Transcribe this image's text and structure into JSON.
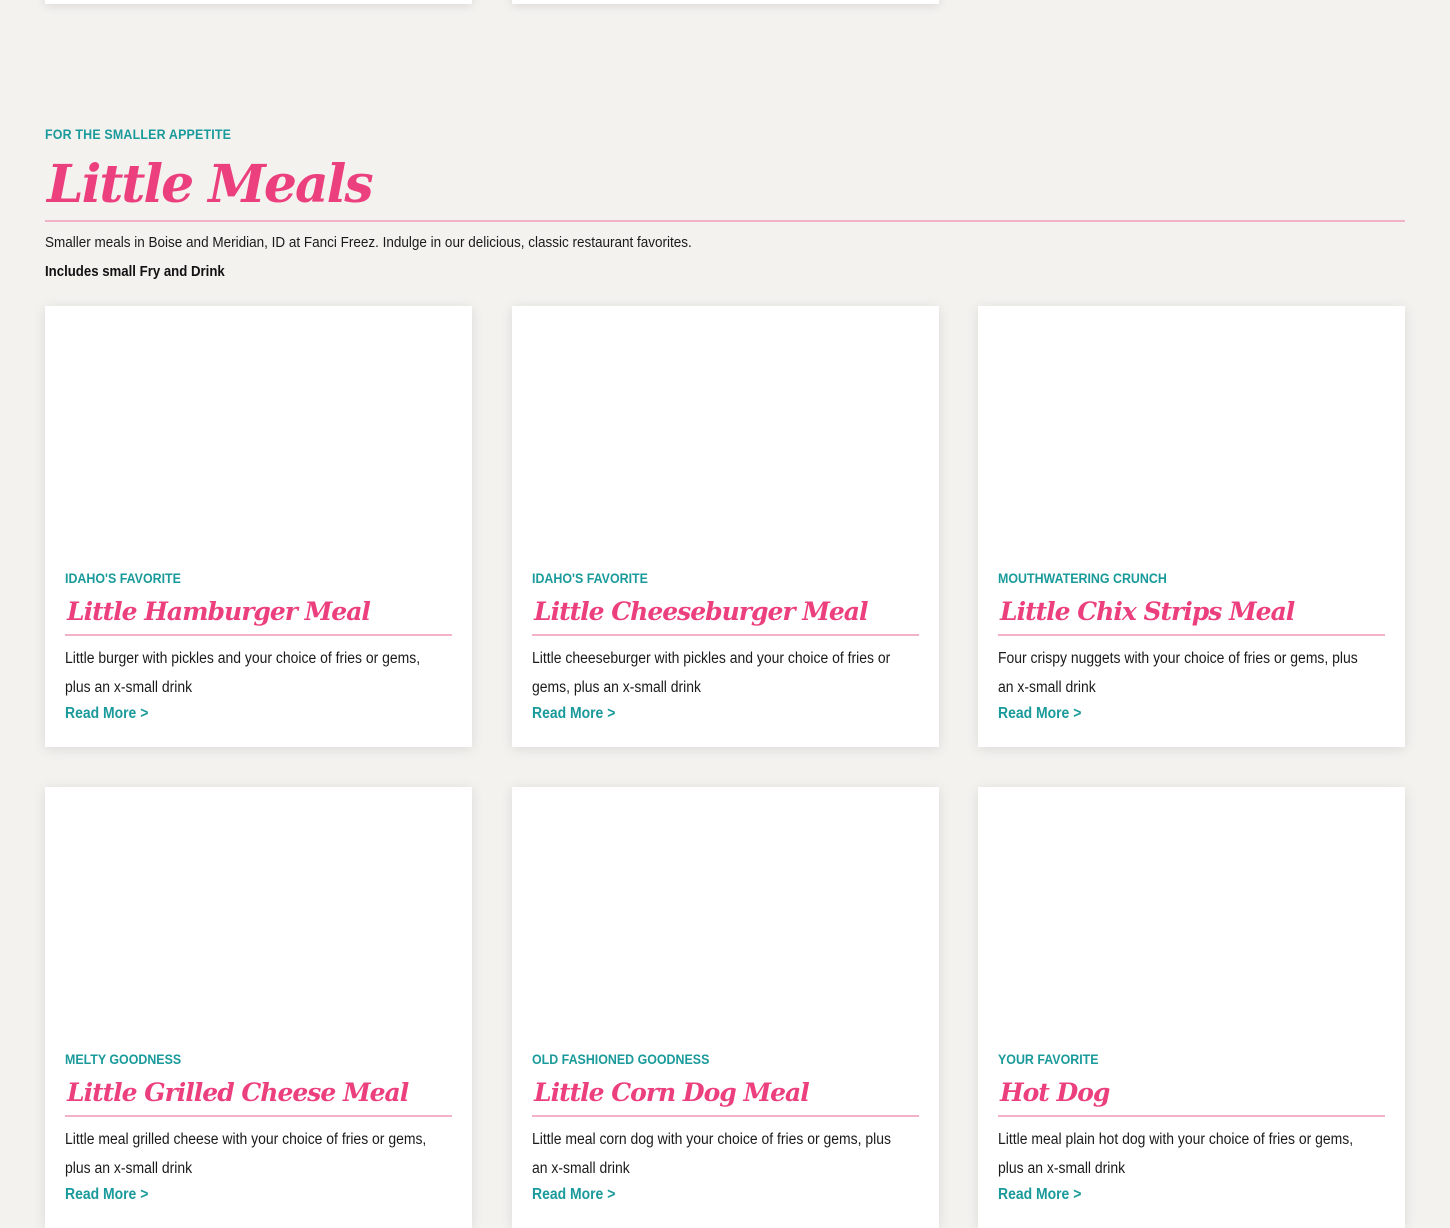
{
  "section": {
    "eyebrow": "FOR THE SMALLER APPETITE",
    "title": "Little Meals",
    "description": "Smaller meals in Boise and Meridian, ID at Fanci Freez. Indulge in our delicious, classic restaurant favorites.",
    "includes": "Includes small Fry and Drink"
  },
  "items": [
    {
      "tag": "IDAHO'S FAVORITE",
      "name": "Little Hamburger Meal",
      "text": "Little burger with pickles and your choice of fries or gems, plus an x-small drink",
      "more": "Read More >"
    },
    {
      "tag": "IDAHO'S FAVORITE",
      "name": "Little Cheeseburger Meal",
      "text": "Little cheeseburger with pickles and your choice of fries or gems, plus an x-small drink",
      "more": "Read More >"
    },
    {
      "tag": "MOUTHWATERING CRUNCH",
      "name": "Little Chix Strips Meal",
      "text": "Four crispy nuggets with your choice of fries or gems, plus an x-small drink",
      "more": "Read More >"
    },
    {
      "tag": "MELTY GOODNESS",
      "name": "Little Grilled Cheese Meal",
      "text": "Little meal grilled cheese with your choice of fries or gems, plus an x-small drink",
      "more": "Read More >"
    },
    {
      "tag": "OLD FASHIONED GOODNESS",
      "name": "Little Corn Dog Meal",
      "text": "Little meal corn dog with your choice of fries or gems, plus an x-small drink",
      "more": "Read More >"
    },
    {
      "tag": "YOUR FAVORITE",
      "name": "Hot Dog",
      "text": "Little meal plain hot dog with your choice of fries or gems, plus an x-small drink",
      "more": "Read More >"
    }
  ],
  "colors": {
    "background": "#f4f2ef",
    "accent_teal": "#1a9a9a",
    "accent_pink": "#ec3f7d",
    "rule_pink": "#f2b3c8"
  }
}
